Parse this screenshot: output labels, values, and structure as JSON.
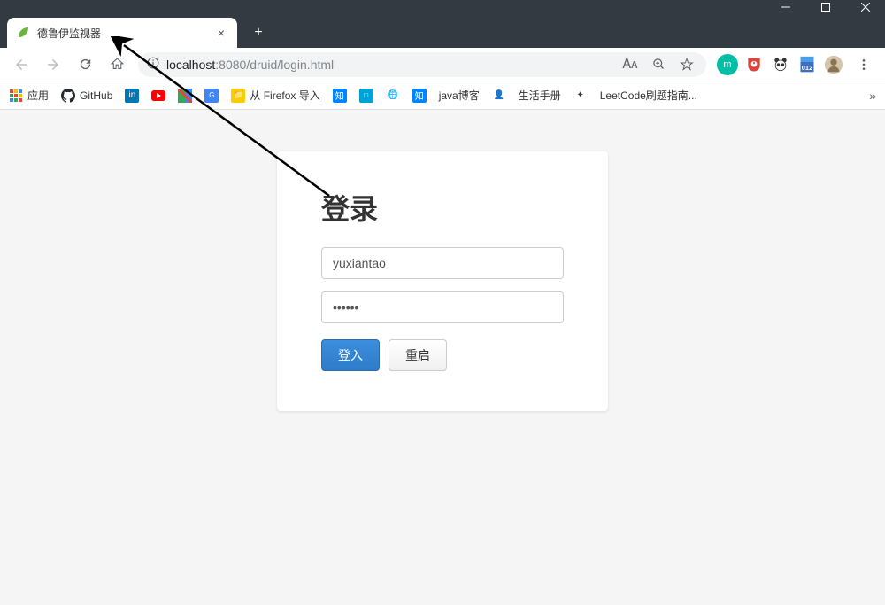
{
  "browser": {
    "tab_title": "德鲁伊监视器",
    "url_host": "localhost",
    "url_port": ":8080",
    "url_path": "/druid/login.html",
    "bookmarks": [
      {
        "label": "应用"
      },
      {
        "label": "GitHub"
      },
      {
        "label": ""
      },
      {
        "label": ""
      },
      {
        "label": ""
      },
      {
        "label": ""
      },
      {
        "label": "从 Firefox 导入"
      },
      {
        "label": ""
      },
      {
        "label": ""
      },
      {
        "label": ""
      },
      {
        "label": ""
      },
      {
        "label": "java博客"
      },
      {
        "label": ""
      },
      {
        "label": "生活手册"
      },
      {
        "label": ""
      },
      {
        "label": "LeetCode刷题指南..."
      }
    ]
  },
  "login": {
    "title": "登录",
    "username_value": "yuxiantao",
    "password_value": "••••••",
    "submit_label": "登入",
    "reset_label": "重启"
  }
}
